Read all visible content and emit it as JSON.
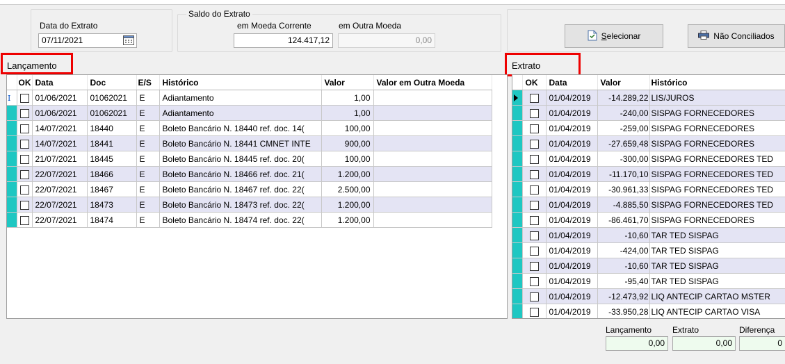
{
  "header": {
    "data_extrato_label": "Data do Extrato",
    "data_extrato_value": "07/11/2021",
    "saldo_group_title": "Saldo do Extrato",
    "moeda_corrente_label": "em Moeda Corrente",
    "moeda_corrente_value": "124.417,12",
    "outra_moeda_label": "em Outra Moeda",
    "outra_moeda_value": "0,00",
    "btn_selecionar_pre": "",
    "btn_selecionar_underline": "S",
    "btn_selecionar_rest": "elecionar",
    "btn_nao_conciliados": "Não Conciliados"
  },
  "lancamento": {
    "title": "Lançamento",
    "columns": [
      "OK",
      "Data",
      "Doc",
      "E/S",
      "Histórico",
      "Valor",
      "Valor em Outra Moeda"
    ],
    "rows": [
      {
        "data": "01/06/2021",
        "doc": "01062021",
        "es": "E",
        "historico": "Adiantamento",
        "valor": "1,00",
        "outra": ""
      },
      {
        "data": "01/06/2021",
        "doc": "01062021",
        "es": "E",
        "historico": "Adiantamento",
        "valor": "1,00",
        "outra": ""
      },
      {
        "data": "14/07/2021",
        "doc": "18440",
        "es": "E",
        "historico": "Boleto Bancário N. 18440 ref. doc. 14(",
        "valor": "100,00",
        "outra": ""
      },
      {
        "data": "14/07/2021",
        "doc": "18441",
        "es": "E",
        "historico": "Boleto Bancário N. 18441 CMNET INTE",
        "valor": "900,00",
        "outra": ""
      },
      {
        "data": "21/07/2021",
        "doc": "18445",
        "es": "E",
        "historico": "Boleto Bancário N. 18445 ref. doc. 20(",
        "valor": "100,00",
        "outra": ""
      },
      {
        "data": "22/07/2021",
        "doc": "18466",
        "es": "E",
        "historico": "Boleto Bancário N. 18466 ref. doc. 21(",
        "valor": "1.200,00",
        "outra": ""
      },
      {
        "data": "22/07/2021",
        "doc": "18467",
        "es": "E",
        "historico": "Boleto Bancário N. 18467 ref. doc. 22(",
        "valor": "2.500,00",
        "outra": ""
      },
      {
        "data": "22/07/2021",
        "doc": "18473",
        "es": "E",
        "historico": "Boleto Bancário N. 18473 ref. doc. 22(",
        "valor": "1.200,00",
        "outra": ""
      },
      {
        "data": "22/07/2021",
        "doc": "18474",
        "es": "E",
        "historico": "Boleto Bancário N. 18474 ref. doc. 22(",
        "valor": "1.200,00",
        "outra": ""
      }
    ]
  },
  "extrato": {
    "title": "Extrato",
    "columns": [
      "OK",
      "Data",
      "Valor",
      "Histórico"
    ],
    "rows": [
      {
        "data": "01/04/2019",
        "valor": "-14.289,22",
        "historico": "LIS/JUROS"
      },
      {
        "data": "01/04/2019",
        "valor": "-240,00",
        "historico": "SISPAG FORNECEDORES"
      },
      {
        "data": "01/04/2019",
        "valor": "-259,00",
        "historico": "SISPAG FORNECEDORES"
      },
      {
        "data": "01/04/2019",
        "valor": "-27.659,48",
        "historico": "SISPAG FORNECEDORES"
      },
      {
        "data": "01/04/2019",
        "valor": "-300,00",
        "historico": "SISPAG FORNECEDORES TED"
      },
      {
        "data": "01/04/2019",
        "valor": "-11.170,10",
        "historico": "SISPAG FORNECEDORES TED"
      },
      {
        "data": "01/04/2019",
        "valor": "-30.961,33",
        "historico": "SISPAG FORNECEDORES TED"
      },
      {
        "data": "01/04/2019",
        "valor": "-4.885,50",
        "historico": "SISPAG FORNECEDORES TED"
      },
      {
        "data": "01/04/2019",
        "valor": "-86.461,70",
        "historico": "SISPAG FORNECEDORES"
      },
      {
        "data": "01/04/2019",
        "valor": "-10,60",
        "historico": "TAR TED SISPAG"
      },
      {
        "data": "01/04/2019",
        "valor": "-424,00",
        "historico": "TAR TED SISPAG"
      },
      {
        "data": "01/04/2019",
        "valor": "-10,60",
        "historico": "TAR TED SISPAG"
      },
      {
        "data": "01/04/2019",
        "valor": "-95,40",
        "historico": "TAR TED SISPAG"
      },
      {
        "data": "01/04/2019",
        "valor": "-12.473,92",
        "historico": "LIQ ANTECIP CARTAO MSTER"
      },
      {
        "data": "01/04/2019",
        "valor": "-33.950,28",
        "historico": "LIQ ANTECIP CARTAO VISA"
      }
    ]
  },
  "footer": {
    "lancamento_label": "Lançamento",
    "lancamento_value": "0,00",
    "extrato_label": "Extrato",
    "extrato_value": "0,00",
    "diferenca_label": "Diferença",
    "diferenca_value": "0"
  },
  "colors": {
    "indicator": "#1ec7c2",
    "alt_row": "#e4e4f4",
    "highlight_box": "#ee0000",
    "footer_field": "#eefbee"
  },
  "icons": {
    "calendar": "calendar-icon",
    "selecionar": "select-document-icon",
    "nao_conciliados": "printer-icon",
    "current_row": "row-pointer-icon",
    "text_cursor": "text-cursor-icon"
  }
}
